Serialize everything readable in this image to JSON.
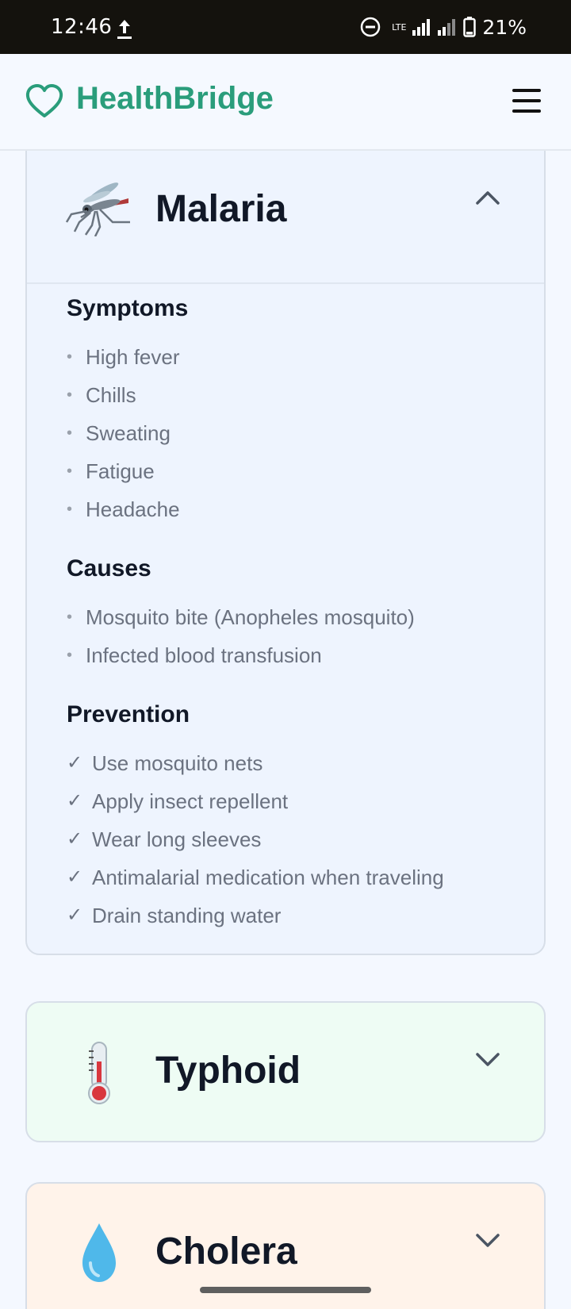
{
  "status_bar": {
    "time": "12:46",
    "network": "LTE",
    "battery": "21%"
  },
  "header": {
    "brand": "HealthBridge"
  },
  "diseases": [
    {
      "name": "Malaria",
      "icon": "mosquito-icon",
      "expanded": true,
      "symptoms_title": "Symptoms",
      "symptoms": [
        "High fever",
        "Chills",
        "Sweating",
        "Fatigue",
        "Headache"
      ],
      "causes_title": "Causes",
      "causes": [
        "Mosquito bite (Anopheles mosquito)",
        "Infected blood transfusion"
      ],
      "prevention_title": "Prevention",
      "prevention_check": "✓",
      "prevention": [
        "Use mosquito nets",
        "Apply insect repellent",
        "Wear long sleeves",
        "Antimalarial medication when traveling",
        "Drain standing water"
      ],
      "color": "#eef4fe"
    },
    {
      "name": "Typhoid",
      "icon": "thermometer-icon",
      "expanded": false,
      "color": "#eefcf4"
    },
    {
      "name": "Cholera",
      "icon": "droplet-icon",
      "expanded": false,
      "color": "#fff3ea"
    }
  ],
  "colors": {
    "brand": "#2a9d7b",
    "status_bar": "#14120d"
  }
}
